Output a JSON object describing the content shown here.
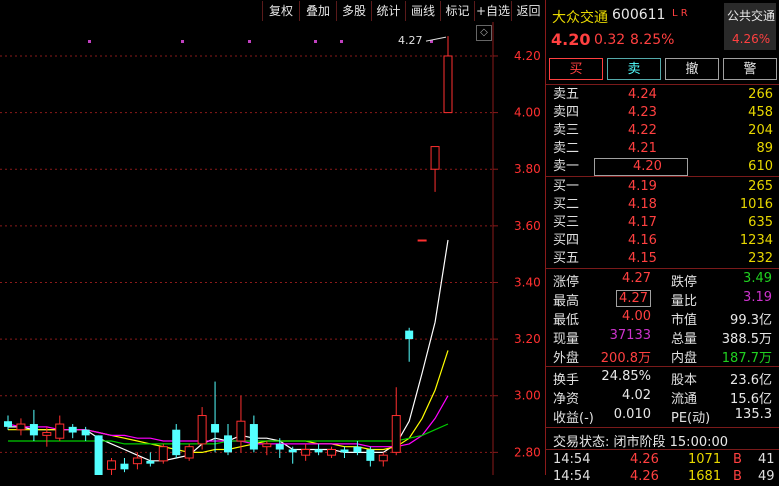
{
  "toolbar": {
    "buttons": [
      "复权",
      "叠加",
      "多股",
      "统计",
      "画线",
      "标记",
      "+自选",
      "返回"
    ]
  },
  "chart": {
    "y_labels": [
      "4.20",
      "4.00",
      "3.80",
      "3.60",
      "3.40",
      "3.20",
      "3.00",
      "2.80"
    ],
    "high_annotation": "4.27",
    "nav_icon": "diamond-icon",
    "colors": {
      "up": "#ff3030",
      "down": "#54ffff",
      "ma5": "#ffffff",
      "ma10": "#ffff00",
      "ma20": "#ff00ff",
      "ma60": "#00cc00",
      "grid": "#8a1a1a",
      "axis_text": "#ff3030",
      "marker": "#c040c0"
    }
  },
  "chart_data": {
    "type": "candlestick",
    "ylim": [
      2.72,
      4.32
    ],
    "candles": [
      {
        "o": 2.91,
        "h": 2.93,
        "l": 2.88,
        "c": 2.89
      },
      {
        "o": 2.88,
        "h": 2.92,
        "l": 2.86,
        "c": 2.9
      },
      {
        "o": 2.9,
        "h": 2.95,
        "l": 2.84,
        "c": 2.86
      },
      {
        "o": 2.86,
        "h": 2.89,
        "l": 2.82,
        "c": 2.87
      },
      {
        "o": 2.85,
        "h": 2.93,
        "l": 2.84,
        "c": 2.9
      },
      {
        "o": 2.89,
        "h": 2.9,
        "l": 2.85,
        "c": 2.87
      },
      {
        "o": 2.88,
        "h": 2.89,
        "l": 2.84,
        "c": 2.86
      },
      {
        "o": 2.86,
        "h": 2.86,
        "l": 2.7,
        "c": 2.71
      },
      {
        "o": 2.74,
        "h": 2.78,
        "l": 2.71,
        "c": 2.77
      },
      {
        "o": 2.76,
        "h": 2.78,
        "l": 2.73,
        "c": 2.74
      },
      {
        "o": 2.76,
        "h": 2.8,
        "l": 2.74,
        "c": 2.78
      },
      {
        "o": 2.77,
        "h": 2.8,
        "l": 2.75,
        "c": 2.76
      },
      {
        "o": 2.77,
        "h": 2.83,
        "l": 2.76,
        "c": 2.82
      },
      {
        "o": 2.88,
        "h": 2.9,
        "l": 2.78,
        "c": 2.79
      },
      {
        "o": 2.78,
        "h": 2.83,
        "l": 2.77,
        "c": 2.82
      },
      {
        "o": 2.83,
        "h": 2.96,
        "l": 2.81,
        "c": 2.93
      },
      {
        "o": 2.9,
        "h": 3.05,
        "l": 2.8,
        "c": 2.87
      },
      {
        "o": 2.86,
        "h": 2.9,
        "l": 2.79,
        "c": 2.8
      },
      {
        "o": 2.84,
        "h": 3.0,
        "l": 2.8,
        "c": 2.91
      },
      {
        "o": 2.9,
        "h": 2.93,
        "l": 2.8,
        "c": 2.81
      },
      {
        "o": 2.82,
        "h": 2.84,
        "l": 2.79,
        "c": 2.83
      },
      {
        "o": 2.83,
        "h": 2.85,
        "l": 2.78,
        "c": 2.81
      },
      {
        "o": 2.81,
        "h": 2.82,
        "l": 2.76,
        "c": 2.8
      },
      {
        "o": 2.79,
        "h": 2.83,
        "l": 2.77,
        "c": 2.81
      },
      {
        "o": 2.81,
        "h": 2.83,
        "l": 2.79,
        "c": 2.8
      },
      {
        "o": 2.79,
        "h": 2.82,
        "l": 2.78,
        "c": 2.81
      },
      {
        "o": 2.81,
        "h": 2.82,
        "l": 2.78,
        "c": 2.8
      },
      {
        "o": 2.82,
        "h": 2.84,
        "l": 2.79,
        "c": 2.8
      },
      {
        "o": 2.81,
        "h": 2.82,
        "l": 2.75,
        "c": 2.77
      },
      {
        "o": 2.77,
        "h": 2.8,
        "l": 2.75,
        "c": 2.79
      },
      {
        "o": 2.8,
        "h": 3.03,
        "l": 2.79,
        "c": 2.93
      },
      {
        "o": 3.23,
        "h": 3.24,
        "l": 3.12,
        "c": 3.2
      },
      {
        "o": 3.55,
        "h": 3.55,
        "l": 3.55,
        "c": 3.55
      },
      {
        "o": 3.8,
        "h": 3.88,
        "l": 3.72,
        "c": 3.88
      },
      {
        "o": 4.0,
        "h": 4.27,
        "l": 4.0,
        "c": 4.2
      }
    ],
    "ma_lines": {
      "ma5": [
        2.89,
        2.89,
        2.88,
        2.88,
        2.88,
        2.88,
        2.88,
        2.85,
        2.83,
        2.81,
        2.79,
        2.77,
        2.77,
        2.78,
        2.79,
        2.83,
        2.85,
        2.84,
        2.86,
        2.85,
        2.85,
        2.84,
        2.81,
        2.81,
        2.81,
        2.81,
        2.8,
        2.8,
        2.8,
        2.8,
        2.83,
        2.91,
        3.08,
        3.26,
        3.55
      ],
      "ma10": [
        2.88,
        2.88,
        2.88,
        2.88,
        2.88,
        2.88,
        2.88,
        2.87,
        2.86,
        2.85,
        2.84,
        2.83,
        2.82,
        2.81,
        2.8,
        2.8,
        2.81,
        2.81,
        2.82,
        2.83,
        2.84,
        2.84,
        2.84,
        2.84,
        2.83,
        2.83,
        2.82,
        2.82,
        2.81,
        2.81,
        2.82,
        2.85,
        2.92,
        3.02,
        3.16
      ],
      "ma20": [
        2.9,
        2.89,
        2.89,
        2.89,
        2.88,
        2.88,
        2.88,
        2.87,
        2.86,
        2.86,
        2.85,
        2.85,
        2.84,
        2.84,
        2.84,
        2.84,
        2.84,
        2.84,
        2.84,
        2.83,
        2.83,
        2.83,
        2.83,
        2.83,
        2.83,
        2.83,
        2.83,
        2.83,
        2.82,
        2.82,
        2.82,
        2.83,
        2.86,
        2.92,
        3.0
      ],
      "ma60": [
        2.84,
        2.84,
        2.84,
        2.84,
        2.84,
        2.84,
        2.84,
        2.84,
        2.84,
        2.83,
        2.83,
        2.83,
        2.83,
        2.83,
        2.83,
        2.83,
        2.83,
        2.84,
        2.84,
        2.84,
        2.84,
        2.84,
        2.84,
        2.84,
        2.84,
        2.84,
        2.84,
        2.84,
        2.84,
        2.84,
        2.84,
        2.85,
        2.86,
        2.88,
        2.9
      ]
    },
    "markers": [
      8,
      17,
      23,
      30,
      32,
      35
    ],
    "high_label": "4.27"
  },
  "quote": {
    "name": "大众交通",
    "code": "600611",
    "flags": "L R",
    "badge_name": "公共交通",
    "badge_pct": "4.26%",
    "price": "4.20",
    "change": "0.32",
    "change_pct": "8.25%",
    "buttons": [
      "买",
      "卖",
      "撤",
      "警"
    ],
    "asks": [
      {
        "label": "卖五",
        "price": "4.24",
        "vol": "266"
      },
      {
        "label": "卖四",
        "price": "4.23",
        "vol": "458"
      },
      {
        "label": "卖三",
        "price": "4.22",
        "vol": "204"
      },
      {
        "label": "卖二",
        "price": "4.21",
        "vol": "89"
      },
      {
        "label": "卖一",
        "price": "4.20",
        "vol": "610"
      }
    ],
    "bids": [
      {
        "label": "买一",
        "price": "4.19",
        "vol": "265"
      },
      {
        "label": "买二",
        "price": "4.18",
        "vol": "1016"
      },
      {
        "label": "买三",
        "price": "4.17",
        "vol": "635"
      },
      {
        "label": "买四",
        "price": "4.16",
        "vol": "1234"
      },
      {
        "label": "买五",
        "price": "4.15",
        "vol": "232"
      }
    ],
    "stats": {
      "zhangting_l": "涨停",
      "zhangting_v": "4.27",
      "dieting_l": "跌停",
      "dieting_v": "3.49",
      "high_l": "最高",
      "high_v": "4.27",
      "liangbi_l": "量比",
      "liangbi_v": "3.19",
      "low_l": "最低",
      "low_v": "4.00",
      "shizhi_l": "市值",
      "shizhi_v": "99.3亿",
      "xianliang_l": "现量",
      "xianliang_v": "37133",
      "zongliang_l": "总量",
      "zongliang_v": "388.5万",
      "waipan_l": "外盘",
      "waipan_v": "200.8万",
      "neipan_l": "内盘",
      "neipan_v": "187.7万",
      "huanshou_l": "换手",
      "huanshou_v": "24.85%",
      "guben_l": "股本",
      "guben_v": "23.6亿",
      "jingzi_l": "净资",
      "jingzi_v": "4.02",
      "liutong_l": "流通",
      "liutong_v": "15.6亿",
      "shouyi_l": "收益(-)",
      "shouyi_v": "0.010",
      "pe_l": "PE(动)",
      "pe_v": "135.3"
    },
    "trade_status": "交易状态: 闭市阶段 15:00:00",
    "ticks": [
      {
        "time": "14:54",
        "price": "4.26",
        "vol": "1071",
        "side": "B",
        "num": "41"
      },
      {
        "time": "14:54",
        "price": "4.26",
        "vol": "1681",
        "side": "B",
        "num": "49"
      }
    ]
  }
}
